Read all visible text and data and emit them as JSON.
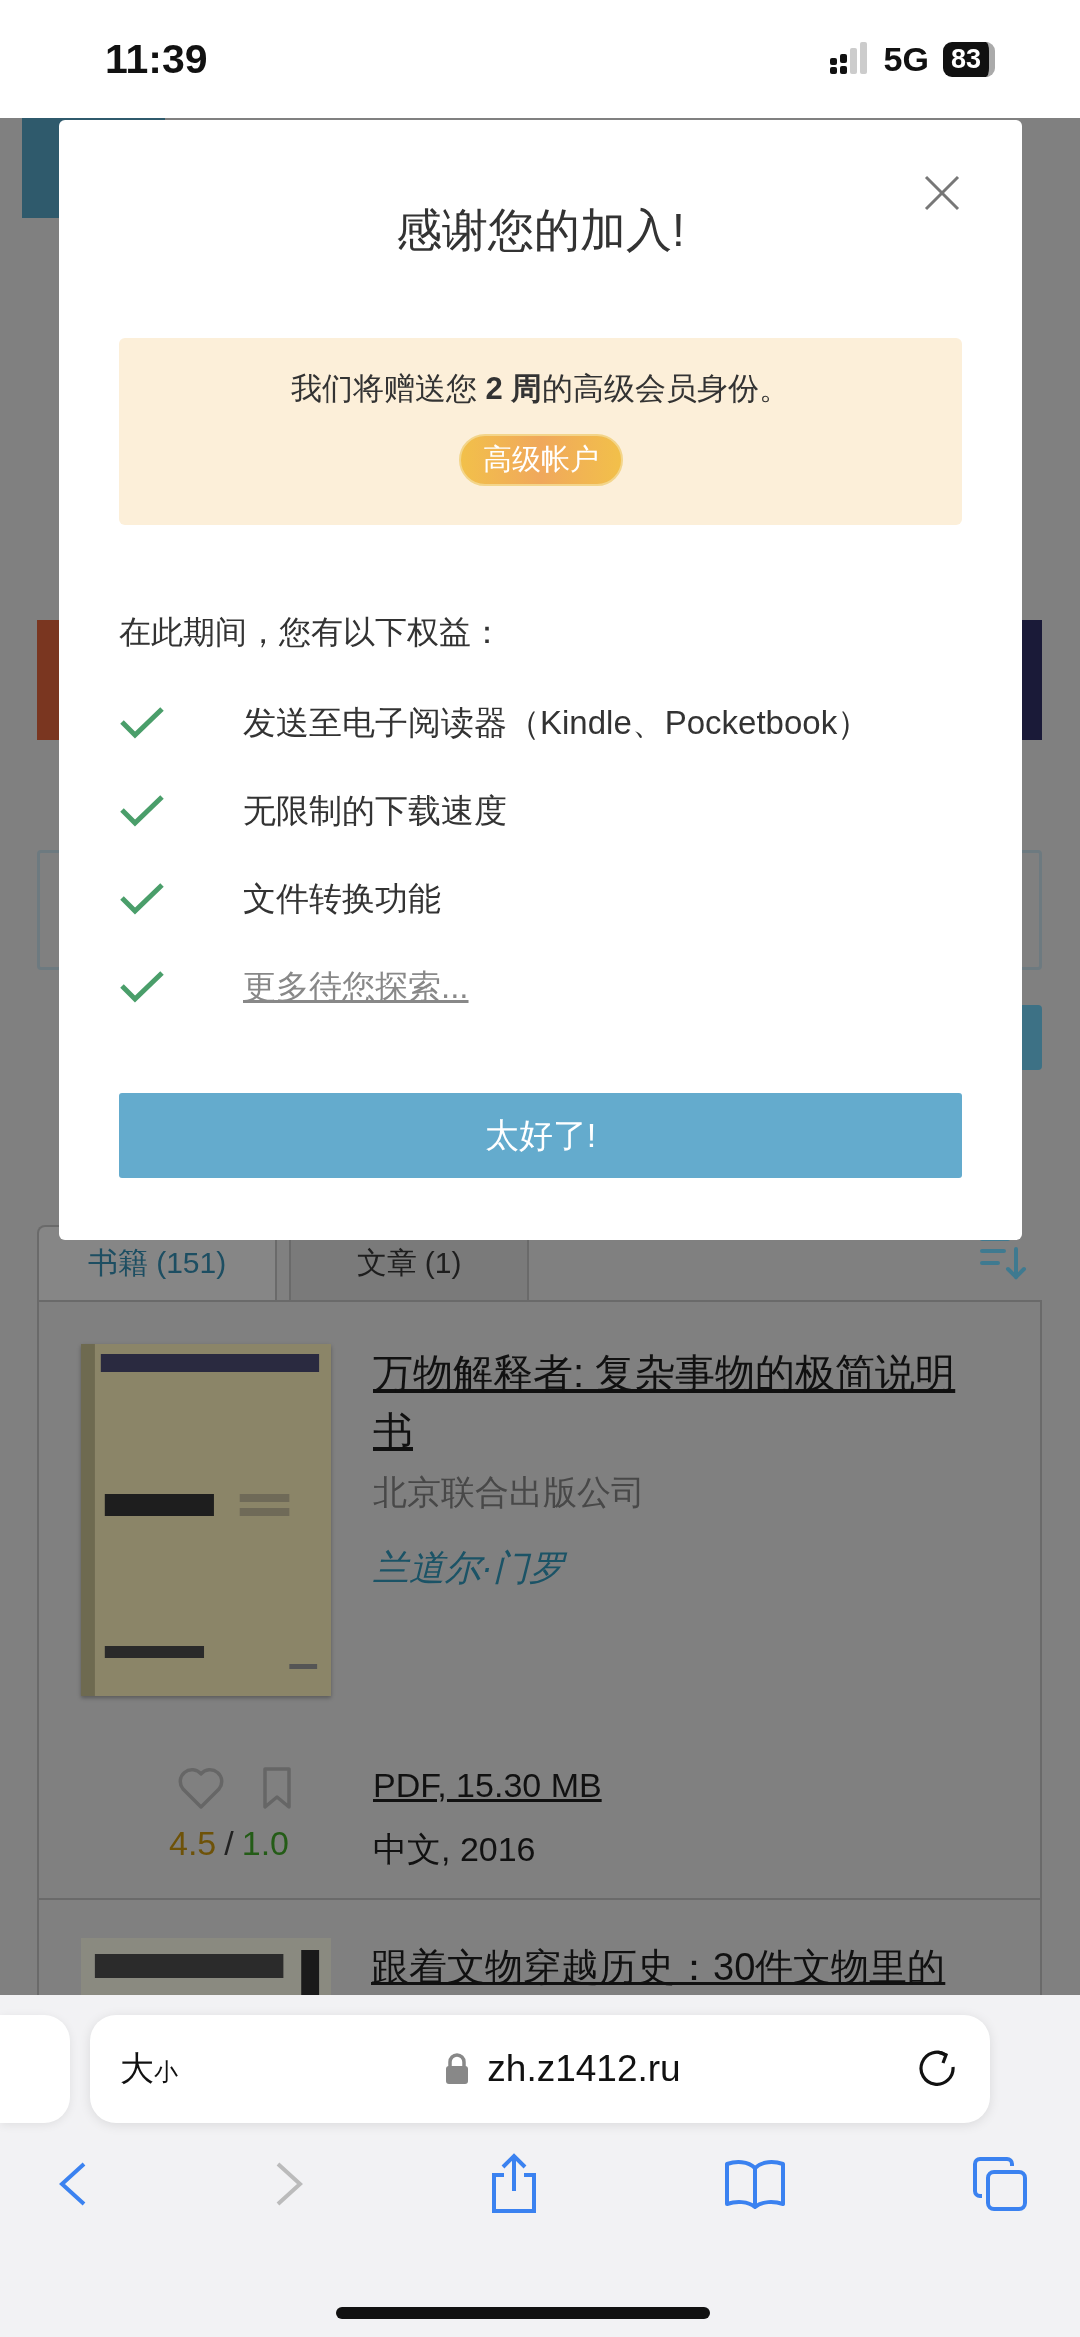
{
  "status_bar": {
    "time": "11:39",
    "network": "5G",
    "battery": "83"
  },
  "modal": {
    "title": "感谢您的加入!",
    "promo_text": "我们将赠送您 **2 周**的高级会员身份。",
    "badge": "高级帐户",
    "benefits_heading": "在此期间，您有以下权益：",
    "benefits": [
      {
        "kind": "text",
        "label": "发送至电子阅读器（Kindle、Pocketbook）"
      },
      {
        "kind": "text",
        "label": "无限制的下载速度"
      },
      {
        "kind": "text",
        "label": "文件转换功能"
      },
      {
        "kind": "link",
        "label": "更多待您探索..."
      }
    ],
    "confirm_button": "太好了!"
  },
  "tabs": [
    {
      "label": "书籍 (151)",
      "selected": true
    },
    {
      "label": "文章 (1)",
      "selected": false
    }
  ],
  "books": [
    {
      "title": "万物解释者: 复杂事物的极简说明书",
      "publisher": "北京联合出版公司",
      "author": "兰道尔·门罗",
      "file": "PDF, 15.30 MB",
      "language_year": "中文, 2016",
      "rating": "4.5",
      "rating_separator": "/",
      "quality": "1.0"
    },
    {
      "title": "跟着文物穿越历史：30件文物里的"
    }
  ],
  "browser": {
    "text_size_button": "大小",
    "url": "zh.z1412.ru",
    "toolbar": [
      {
        "kind": "back",
        "disabled": false
      },
      {
        "kind": "forward",
        "disabled": true
      },
      {
        "kind": "share",
        "disabled": false
      },
      {
        "kind": "bookmarks",
        "disabled": false
      },
      {
        "kind": "tabs",
        "disabled": false
      }
    ]
  }
}
